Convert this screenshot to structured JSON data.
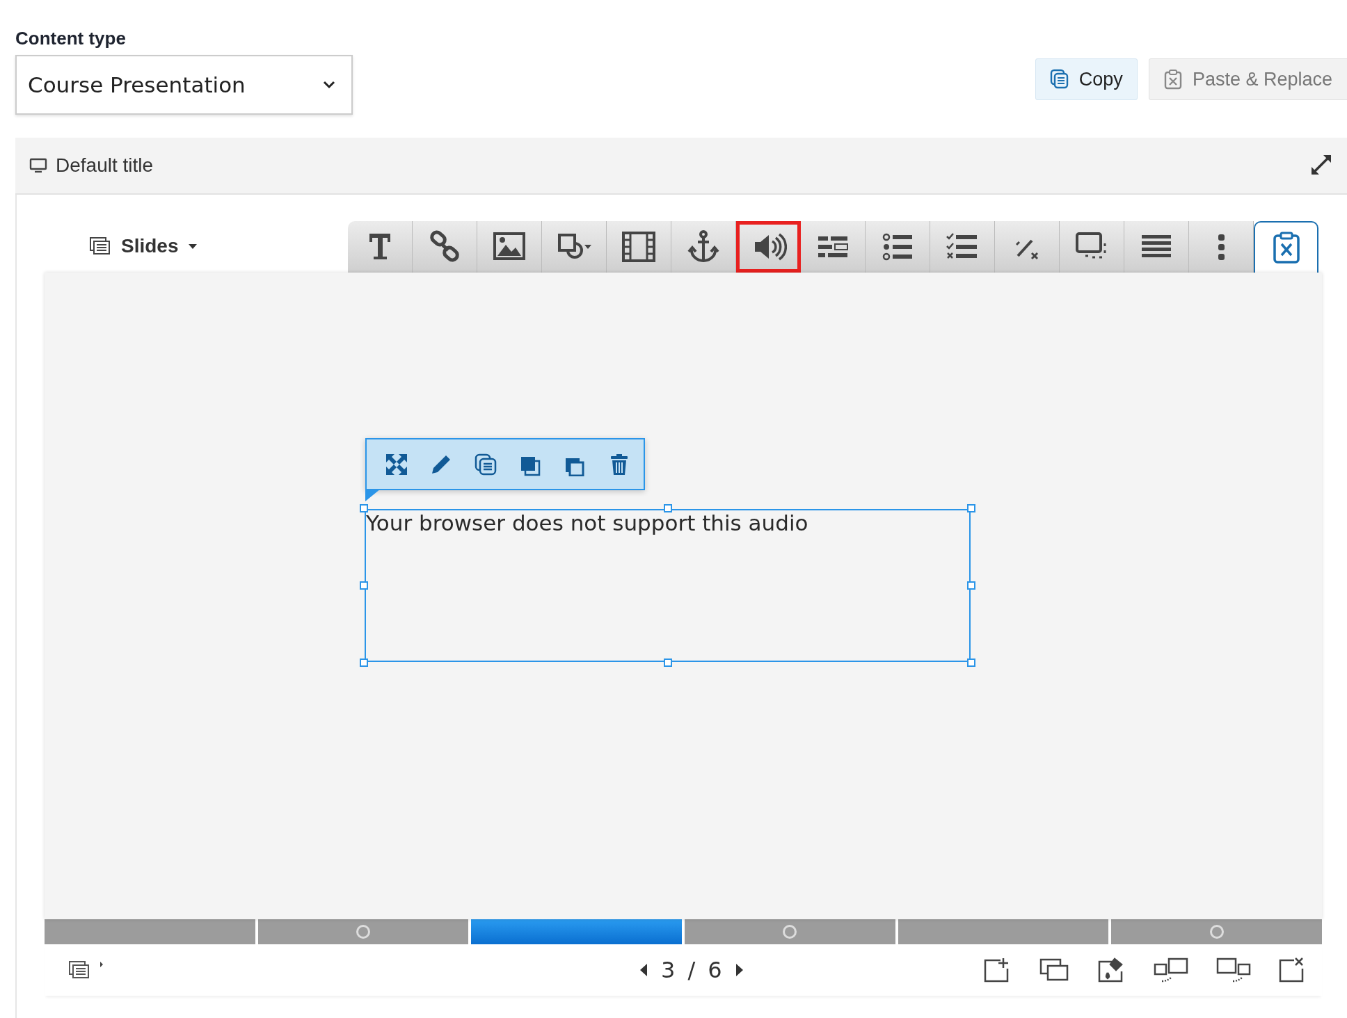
{
  "content_type": {
    "label": "Content type",
    "value": "Course Presentation"
  },
  "actions": [
    {
      "label": "Copy",
      "disabled": false
    },
    {
      "label": "Paste & Replace",
      "disabled": true
    }
  ],
  "header": {
    "title": "Default title"
  },
  "slides_menu": {
    "label": "Slides"
  },
  "toolbar": [
    {
      "selected": false,
      "highlighted": false
    },
    {
      "selected": false,
      "highlighted": false
    },
    {
      "selected": false,
      "highlighted": false
    },
    {
      "selected": false,
      "highlighted": false
    },
    {
      "selected": false,
      "highlighted": false
    },
    {
      "selected": false,
      "highlighted": false
    },
    {
      "selected": false,
      "highlighted": true
    },
    {
      "selected": false,
      "highlighted": false
    },
    {
      "selected": false,
      "highlighted": false
    },
    {
      "selected": false,
      "highlighted": false
    },
    {
      "selected": false,
      "highlighted": false
    },
    {
      "selected": false,
      "highlighted": false
    },
    {
      "selected": false,
      "highlighted": false
    },
    {
      "selected": false,
      "highlighted": false
    },
    {
      "selected": true,
      "highlighted": false
    }
  ],
  "audio_element": {
    "message": "Your browser does not support this audio"
  },
  "progress": [
    {
      "selected": false,
      "has_task": false
    },
    {
      "selected": false,
      "has_task": true
    },
    {
      "selected": true,
      "has_task": false
    },
    {
      "selected": false,
      "has_task": true
    },
    {
      "selected": false,
      "has_task": false
    },
    {
      "selected": false,
      "has_task": true
    }
  ],
  "navigation": {
    "current": "3",
    "separator": "/",
    "total": "6"
  }
}
